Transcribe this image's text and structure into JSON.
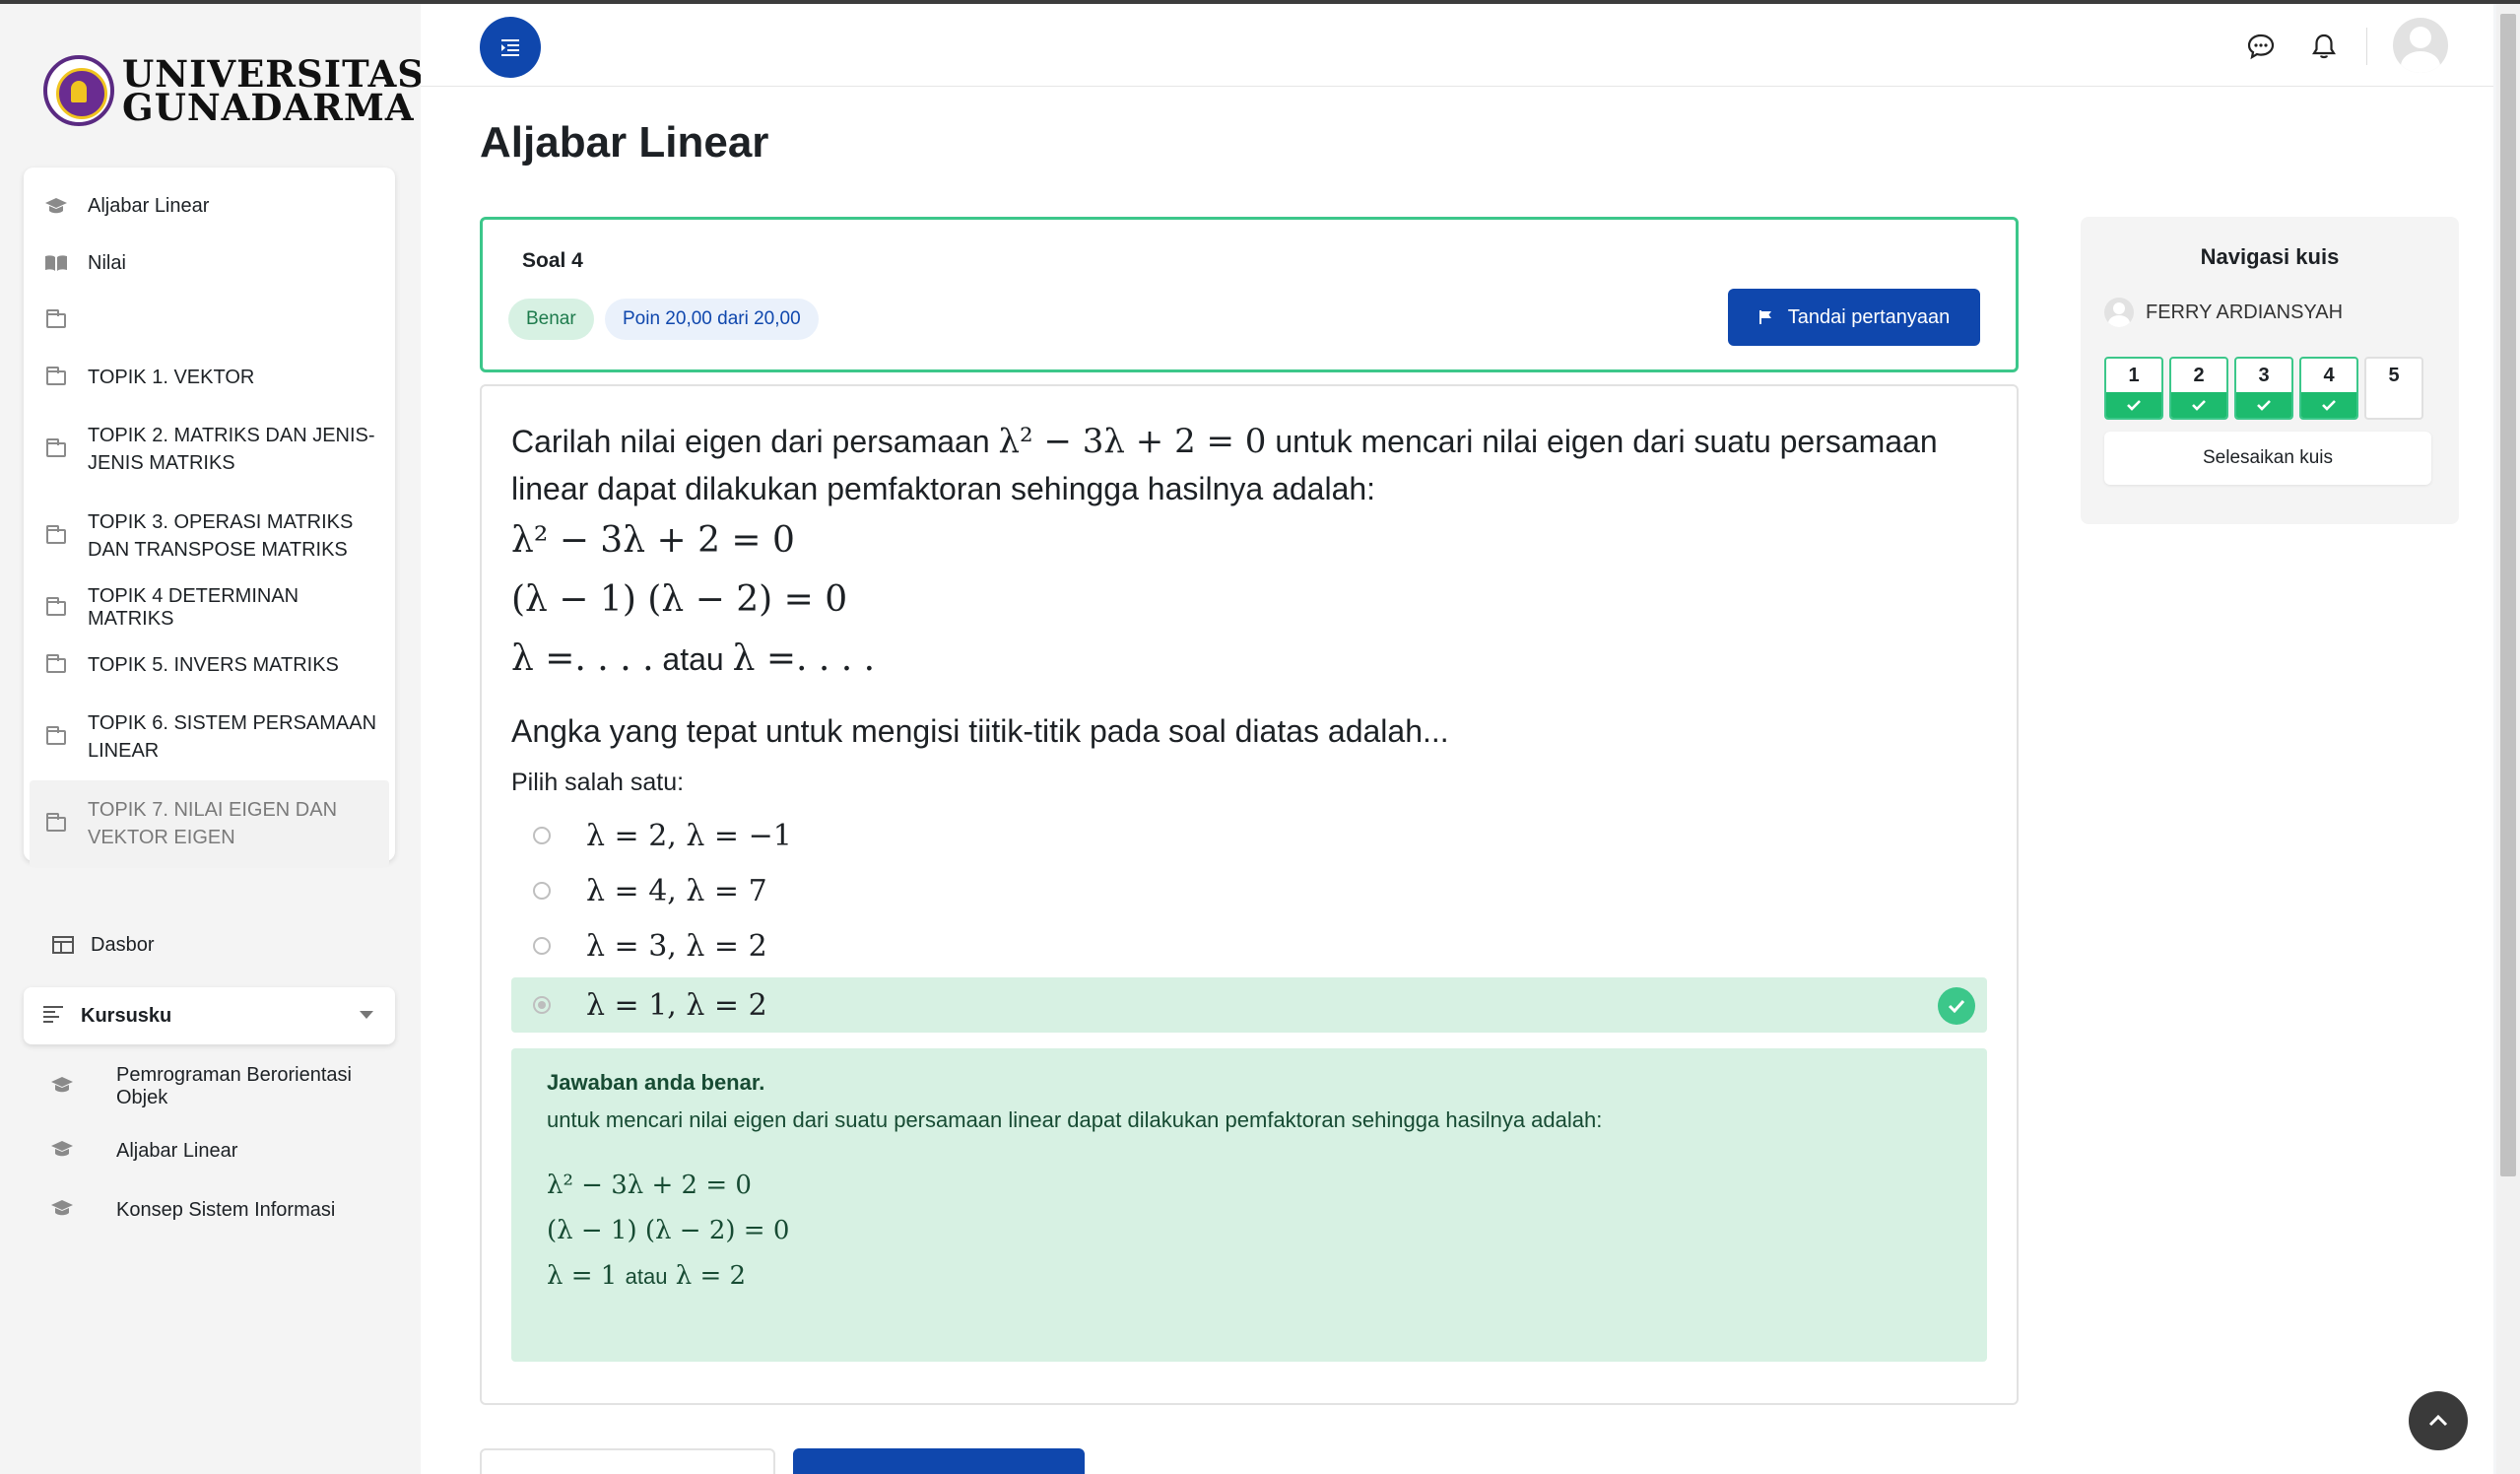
{
  "brand": {
    "line1": "UNIVERSITAS",
    "line2": "GUNADARMA"
  },
  "sidebar": {
    "nav_items": [
      {
        "label": "Aljabar Linear"
      },
      {
        "label": "Nilai"
      },
      {
        "label": ""
      },
      {
        "label": "TOPIK 1. VEKTOR"
      },
      {
        "label": "TOPIK 2. MATRIKS DAN JENIS-JENIS MATRIKS"
      },
      {
        "label": "TOPIK 3. OPERASI MATRIKS DAN TRANSPOSE MATRIKS"
      },
      {
        "label": "TOPIK 4 DETERMINAN MATRIKS"
      },
      {
        "label": "TOPIK 5. INVERS MATRIKS"
      },
      {
        "label": "TOPIK 6. SISTEM PERSAMAAN LINEAR"
      },
      {
        "label": "TOPIK 7. NILAI EIGEN DAN VEKTOR EIGEN"
      }
    ],
    "dasbor": "Dasbor",
    "kursusku": "Kursusku",
    "courses": [
      {
        "label": "Pemrograman Berorientasi Objek"
      },
      {
        "label": "Aljabar Linear"
      },
      {
        "label": "Konsep Sistem Informasi"
      }
    ]
  },
  "page": {
    "title": "Aljabar Linear"
  },
  "question": {
    "number": "Soal 4",
    "status": "Benar",
    "points": "Poin 20,00 dari 20,00",
    "flag_label": "Tandai pertanyaan",
    "intro_pre": "Carilah nilai eigen dari persamaan",
    "intro_math": "λ² − 3λ + 2 = 0",
    "intro_post": "untuk mencari nilai eigen dari suatu persamaan linear dapat dilakukan pemfaktoran sehingga hasilnya adalah:",
    "eq1": "λ² − 3λ + 2 = 0",
    "eq2": "(λ − 1) (λ − 2) = 0",
    "eq3_left": "λ =. . . .",
    "eq3_mid": "atau",
    "eq3_right": "λ =. . . .",
    "prompt": "Angka yang tepat untuk mengisi tiitik-titik pada soal diatas adalah...",
    "choose": "Pilih salah satu:",
    "options": [
      {
        "value": "λ = 2, λ = −1",
        "selected": false
      },
      {
        "value": "λ = 4, λ = 7",
        "selected": false
      },
      {
        "value": "λ = 3, λ = 2",
        "selected": false
      },
      {
        "value": "λ = 1, λ = 2",
        "selected": true
      }
    ]
  },
  "feedback": {
    "heading": "Jawaban anda benar.",
    "text": "untuk mencari nilai eigen dari suatu persamaan linear dapat dilakukan pemfaktoran sehingga hasilnya adalah:",
    "line1": "λ² − 3λ + 2 = 0",
    "line2": "(λ − 1) (λ − 2) = 0",
    "line3_left": "λ = 1",
    "line3_mid": "atau",
    "line3_right": "λ = 2"
  },
  "quiz_nav": {
    "title": "Navigasi kuis",
    "user": "FERRY ARDIANSYAH",
    "questions": [
      {
        "n": "1",
        "done": true
      },
      {
        "n": "2",
        "done": true
      },
      {
        "n": "3",
        "done": true
      },
      {
        "n": "4",
        "done": true
      },
      {
        "n": "5",
        "done": false
      }
    ],
    "finish": "Selesaikan kuis"
  },
  "colors": {
    "primary": "#0f47ad",
    "success": "#3cc78a",
    "success_bg": "#d7f1e3"
  }
}
